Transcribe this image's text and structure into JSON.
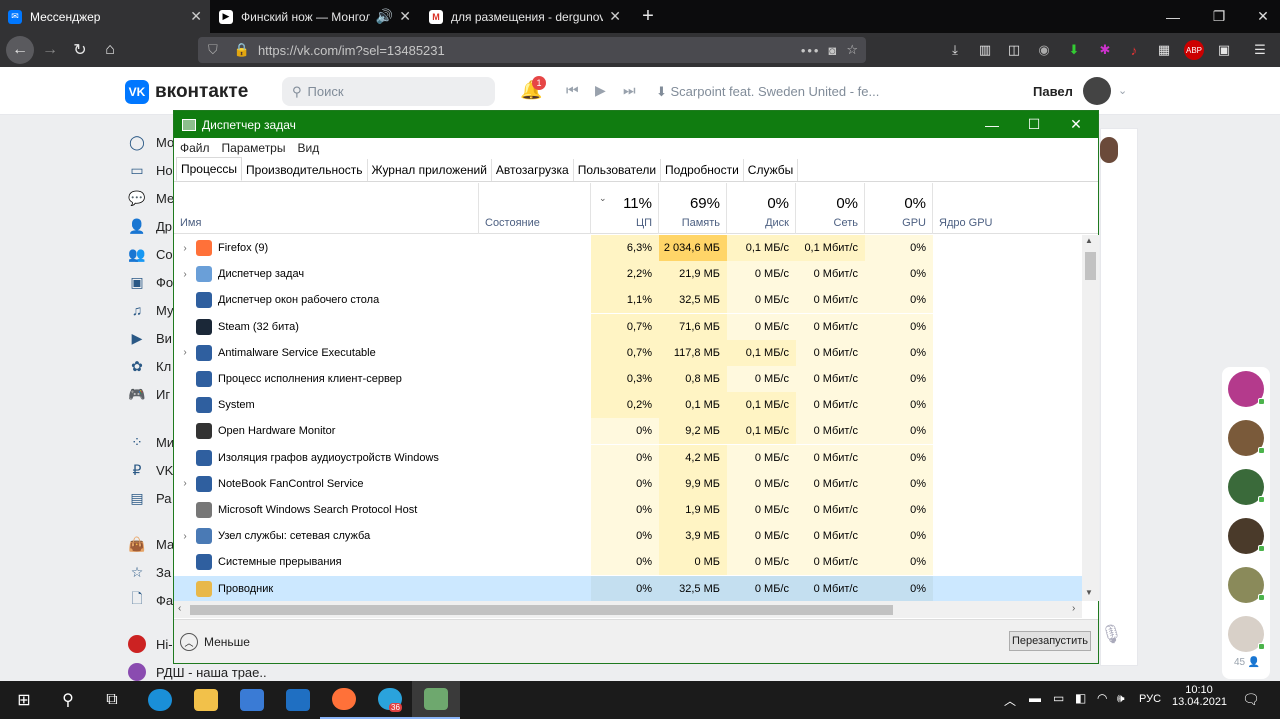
{
  "browser": {
    "tabs": [
      {
        "title": "Мессенджер",
        "fav": "vk-icon"
      },
      {
        "title": "Финский нож — Монгол Ш",
        "fav": "video-icon"
      },
      {
        "title": "для размещения - dergunov.p",
        "fav": "gmail-icon"
      }
    ],
    "url": "https://vk.com/im?sel=13485231",
    "new_tab": "+"
  },
  "vk": {
    "logo_text": "вконтакте",
    "logo_mark": "VK",
    "search_placeholder": "Поиск",
    "notif_count": "1",
    "track": "Scarpoint feat. Sweden United - fe...",
    "user_name": "Павел",
    "left_menu": [
      "Мо",
      "Но",
      "Ме",
      "Др",
      "Со",
      "Фо",
      "Му",
      "Ви",
      "Кл",
      "Иг",
      "Ми",
      "VK",
      "Ра",
      "Ма",
      "За",
      "Фа"
    ],
    "bottom_chats": [
      "Hi-",
      "РДШ - наша трае.."
    ],
    "online_count": "45"
  },
  "taskmgr": {
    "title": "Диспетчер задач",
    "menu": [
      "Файл",
      "Параметры",
      "Вид"
    ],
    "tabs": [
      "Процессы",
      "Производительность",
      "Журнал приложений",
      "Автозагрузка",
      "Пользователи",
      "Подробности",
      "Службы"
    ],
    "header": {
      "name": "Имя",
      "status": "Состояние",
      "cpu_pct": "11%",
      "cpu": "ЦП",
      "mem_pct": "69%",
      "mem": "Память",
      "disk_pct": "0%",
      "disk": "Диск",
      "net_pct": "0%",
      "net": "Сеть",
      "gpu_pct": "0%",
      "gpu": "GPU",
      "gpu_engine": "Ядро GPU"
    },
    "rows": [
      {
        "name": "Firefox (9)",
        "cpu": "6,3%",
        "mem": "2 034,6 МБ",
        "disk": "0,1 МБ/с",
        "net": "0,1 Мбит/с",
        "gpu": "0%"
      },
      {
        "name": "Диспетчер задач",
        "cpu": "2,2%",
        "mem": "21,9 МБ",
        "disk": "0 МБ/с",
        "net": "0 Мбит/с",
        "gpu": "0%"
      },
      {
        "name": "Диспетчер окон рабочего стола",
        "cpu": "1,1%",
        "mem": "32,5 МБ",
        "disk": "0 МБ/с",
        "net": "0 Мбит/с",
        "gpu": "0%"
      },
      {
        "name": "Steam (32 бита)",
        "cpu": "0,7%",
        "mem": "71,6 МБ",
        "disk": "0 МБ/с",
        "net": "0 Мбит/с",
        "gpu": "0%"
      },
      {
        "name": "Antimalware Service Executable",
        "cpu": "0,7%",
        "mem": "117,8 МБ",
        "disk": "0,1 МБ/с",
        "net": "0 Мбит/с",
        "gpu": "0%"
      },
      {
        "name": "Процесс исполнения клиент-сервер",
        "cpu": "0,3%",
        "mem": "0,8 МБ",
        "disk": "0 МБ/с",
        "net": "0 Мбит/с",
        "gpu": "0%"
      },
      {
        "name": "System",
        "cpu": "0,2%",
        "mem": "0,1 МБ",
        "disk": "0,1 МБ/с",
        "net": "0 Мбит/с",
        "gpu": "0%"
      },
      {
        "name": "Open Hardware Monitor",
        "cpu": "0%",
        "mem": "9,2 МБ",
        "disk": "0,1 МБ/с",
        "net": "0 Мбит/с",
        "gpu": "0%"
      },
      {
        "name": "Изоляция графов аудиоустройств Windows",
        "cpu": "0%",
        "mem": "4,2 МБ",
        "disk": "0 МБ/с",
        "net": "0 Мбит/с",
        "gpu": "0%"
      },
      {
        "name": "NoteBook FanControl Service",
        "cpu": "0%",
        "mem": "9,9 МБ",
        "disk": "0 МБ/с",
        "net": "0 Мбит/с",
        "gpu": "0%"
      },
      {
        "name": "Microsoft Windows Search Protocol Host",
        "cpu": "0%",
        "mem": "1,9 МБ",
        "disk": "0 МБ/с",
        "net": "0 Мбит/с",
        "gpu": "0%"
      },
      {
        "name": "Узел службы: сетевая служба",
        "cpu": "0%",
        "mem": "3,9 МБ",
        "disk": "0 МБ/с",
        "net": "0 Мбит/с",
        "gpu": "0%"
      },
      {
        "name": "Системные прерывания",
        "cpu": "0%",
        "mem": "0 МБ",
        "disk": "0 МБ/с",
        "net": "0 Мбит/с",
        "gpu": "0%"
      },
      {
        "name": "Проводник",
        "cpu": "0%",
        "mem": "32,5 МБ",
        "disk": "0 МБ/с",
        "net": "0 Мбит/с",
        "gpu": "0%"
      }
    ],
    "less_label": "Меньше",
    "restart_label": "Перезапустить"
  },
  "taskbar": {
    "lang": "РУС",
    "time": "10:10",
    "date": "13.04.2021",
    "telegram_badge": "36"
  },
  "colors": {
    "tm_title": "#107c10",
    "vk_blue": "#0077ff",
    "cpu_high": "#fff4c4",
    "mem_hot": "#ffd568",
    "row_sel": "#cce8ff"
  }
}
